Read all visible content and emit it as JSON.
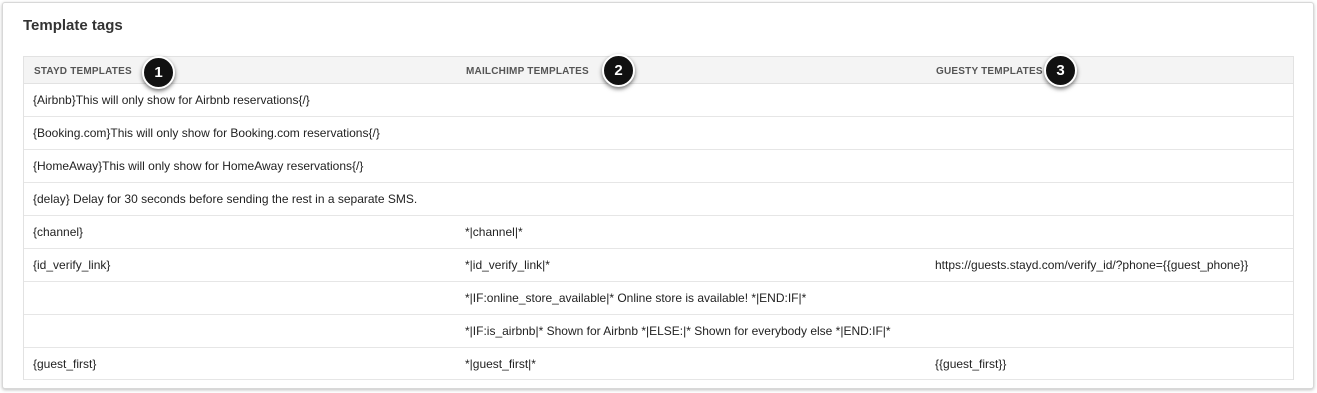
{
  "title": "Template tags",
  "columns": [
    "STAYD TEMPLATES",
    "MAILCHIMP TEMPLATES",
    "GUESTY TEMPLATES"
  ],
  "callouts": [
    "1",
    "2",
    "3"
  ],
  "rows": [
    [
      "{Airbnb}This will only show for Airbnb reservations{/}",
      "",
      ""
    ],
    [
      "{Booking.com}This will only show for Booking.com reservations{/}",
      "",
      ""
    ],
    [
      "{HomeAway}This will only show for HomeAway reservations{/}",
      "",
      ""
    ],
    [
      "{delay} Delay for 30 seconds before sending the rest in a separate SMS.",
      "",
      ""
    ],
    [
      "{channel}",
      "*|channel|*",
      ""
    ],
    [
      "{id_verify_link}",
      "*|id_verify_link|*",
      "https://guests.stayd.com/verify_id/?phone={{guest_phone}}"
    ],
    [
      "",
      "*|IF:online_store_available|* Online store is available! *|END:IF|*",
      ""
    ],
    [
      "",
      "*|IF:is_airbnb|* Shown for Airbnb *|ELSE:|* Shown for everybody else *|END:IF|*",
      ""
    ],
    [
      "{guest_first}",
      "*|guest_first|*",
      "{{guest_first}}"
    ]
  ]
}
